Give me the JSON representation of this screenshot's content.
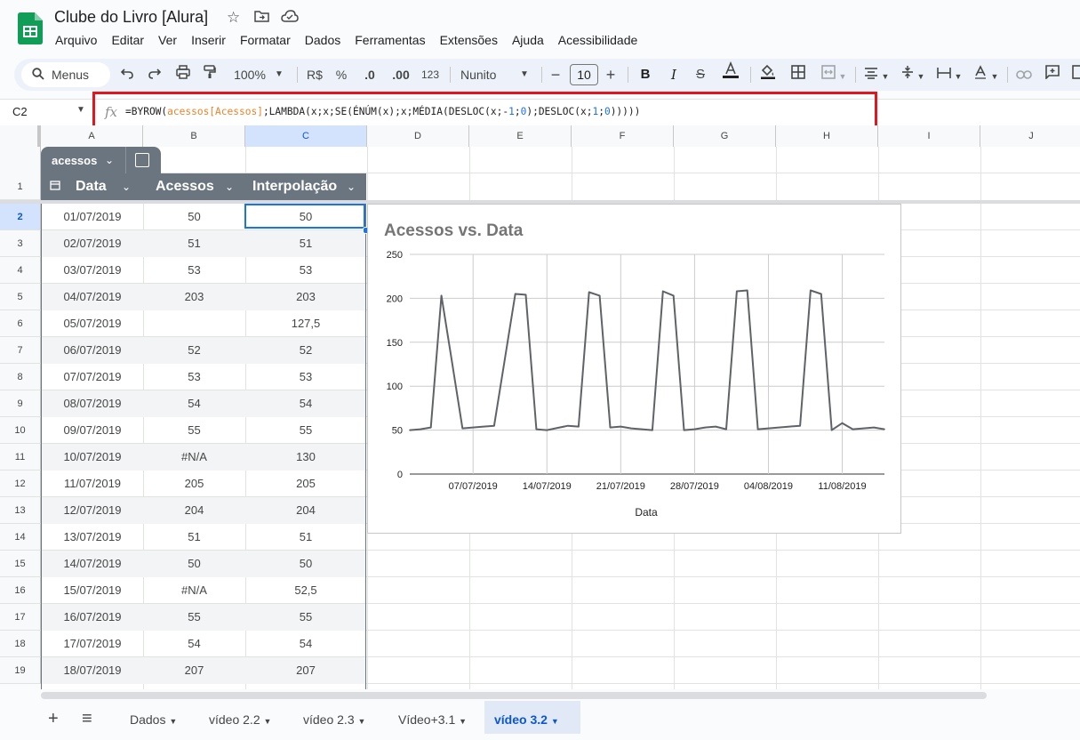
{
  "app": {
    "doc_title": "Clube do Livro [Alura]",
    "menus": [
      "Arquivo",
      "Editar",
      "Ver",
      "Inserir",
      "Formatar",
      "Dados",
      "Ferramentas",
      "Extensões",
      "Ajuda",
      "Acessibilidade"
    ]
  },
  "toolbar": {
    "search_label": "Menus",
    "zoom": "100%",
    "currency": "R$",
    "percent": "%",
    "decrease_decimal": ".0",
    "increase_decimal": ".00",
    "number_format": "123",
    "font": "Nunito",
    "font_size": "10"
  },
  "formula_bar": {
    "cell_ref": "C2",
    "fx_label": "fx",
    "formula_parts": [
      "=BYROW(",
      "acessos[Acessos]",
      ";LAMBDA(x;x;SE(ÉNÚM(x);x;MÉDIA(DESLOC(x;-",
      "1",
      ";",
      "0",
      ");DESLOC(x;",
      "1",
      ";",
      "0",
      ")))))"
    ]
  },
  "columns": [
    "A",
    "B",
    "C",
    "D",
    "E",
    "F",
    "G",
    "H",
    "I",
    "J"
  ],
  "table": {
    "name": "acessos",
    "headers": [
      "Data",
      "Acessos",
      "Interpolação"
    ],
    "rows": [
      [
        "01/07/2019",
        "50",
        "50"
      ],
      [
        "02/07/2019",
        "51",
        "51"
      ],
      [
        "03/07/2019",
        "53",
        "53"
      ],
      [
        "04/07/2019",
        "203",
        "203"
      ],
      [
        "05/07/2019",
        "",
        "127,5"
      ],
      [
        "06/07/2019",
        "52",
        "52"
      ],
      [
        "07/07/2019",
        "53",
        "53"
      ],
      [
        "08/07/2019",
        "54",
        "54"
      ],
      [
        "09/07/2019",
        "55",
        "55"
      ],
      [
        "10/07/2019",
        "#N/A",
        "130"
      ],
      [
        "11/07/2019",
        "205",
        "205"
      ],
      [
        "12/07/2019",
        "204",
        "204"
      ],
      [
        "13/07/2019",
        "51",
        "51"
      ],
      [
        "14/07/2019",
        "50",
        "50"
      ],
      [
        "15/07/2019",
        "#N/A",
        "52,5"
      ],
      [
        "16/07/2019",
        "55",
        "55"
      ],
      [
        "17/07/2019",
        "54",
        "54"
      ],
      [
        "18/07/2019",
        "207",
        "207"
      ]
    ]
  },
  "row_numbers": [
    "1",
    "2",
    "3",
    "4",
    "5",
    "6",
    "7",
    "8",
    "9",
    "10",
    "11",
    "12",
    "13",
    "14",
    "15",
    "16",
    "17",
    "18",
    "19"
  ],
  "chart_data": {
    "type": "line",
    "title": "Acessos vs. Data",
    "xlabel": "Data",
    "ylabel": "",
    "ylim": [
      0,
      250
    ],
    "yticks": [
      "0",
      "50",
      "100",
      "150",
      "200",
      "250"
    ],
    "xticks": [
      "07/07/2019",
      "14/07/2019",
      "21/07/2019",
      "28/07/2019",
      "04/08/2019",
      "11/08/2019"
    ],
    "x_start": "01/07/2019",
    "x_end": "17/08/2019",
    "values": [
      50,
      51,
      53,
      203,
      127.5,
      52,
      53,
      54,
      55,
      130,
      205,
      204,
      51,
      50,
      52.5,
      55,
      54,
      207,
      203,
      53,
      54,
      52,
      51,
      50,
      208,
      203,
      50,
      51,
      53,
      54,
      51,
      208,
      209,
      51,
      52,
      53,
      54,
      55,
      209,
      205,
      50,
      58,
      51,
      52,
      53,
      51
    ],
    "line_color": "#5f6368",
    "grid": true,
    "legend": "none"
  },
  "sheets": {
    "add_label": "+",
    "list_label": "≡",
    "tabs": [
      "Dados",
      "vídeo 2.2",
      "vídeo 2.3",
      "Vídeo+3.1",
      "vídeo 3.2"
    ],
    "active": "vídeo 3.2"
  }
}
